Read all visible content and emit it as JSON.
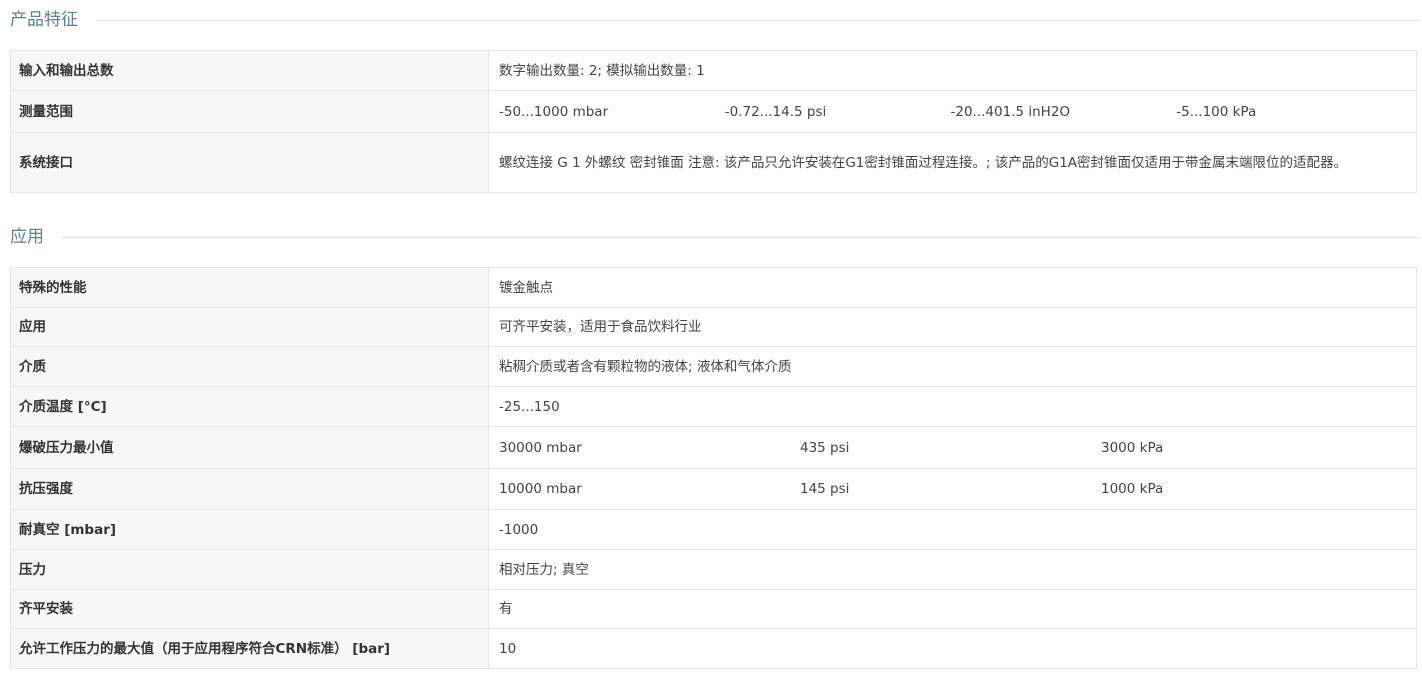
{
  "features": {
    "title": "产品特征",
    "rows": [
      {
        "label": "输入和输出总数",
        "value": "数字输出数量: 2; 模拟输出数量: 1"
      },
      {
        "label": "测量范围",
        "values": [
          "-50...1000 mbar",
          "-0.72...14.5 psi",
          "-20...401.5 inH2O",
          "-5...100 kPa"
        ]
      },
      {
        "label": "系统接口",
        "value": "螺纹连接 G 1 外螺纹 密封锥面 注意: 该产品只允许安装在G1密封锥面过程连接。; 该产品的G1A密封锥面仅适用于带金属末端限位的适配器。"
      }
    ]
  },
  "application": {
    "title": "应用",
    "rows": [
      {
        "label": "特殊的性能",
        "value": "镀金触点"
      },
      {
        "label": "应用",
        "value": "可齐平安装，适用于食品饮料行业"
      },
      {
        "label": "介质",
        "value": "粘稠介质或者含有颗粒物的液体; 液体和气体介质"
      },
      {
        "label": "介质温度 [°C]",
        "value": "-25...150"
      },
      {
        "label": "爆破压力最小值",
        "values": [
          "30000 mbar",
          "435 psi",
          "3000 kPa"
        ]
      },
      {
        "label": "抗压强度",
        "values": [
          "10000 mbar",
          "145 psi",
          "1000 kPa"
        ]
      },
      {
        "label": "耐真空 [mbar]",
        "value": "-1000"
      },
      {
        "label": "压力",
        "value": "相对压力; 真空"
      },
      {
        "label": "齐平安装",
        "value": "有"
      },
      {
        "label": "允许工作压力的最大值（用于应用程序符合CRN标准） [bar]",
        "value": "10"
      }
    ]
  }
}
